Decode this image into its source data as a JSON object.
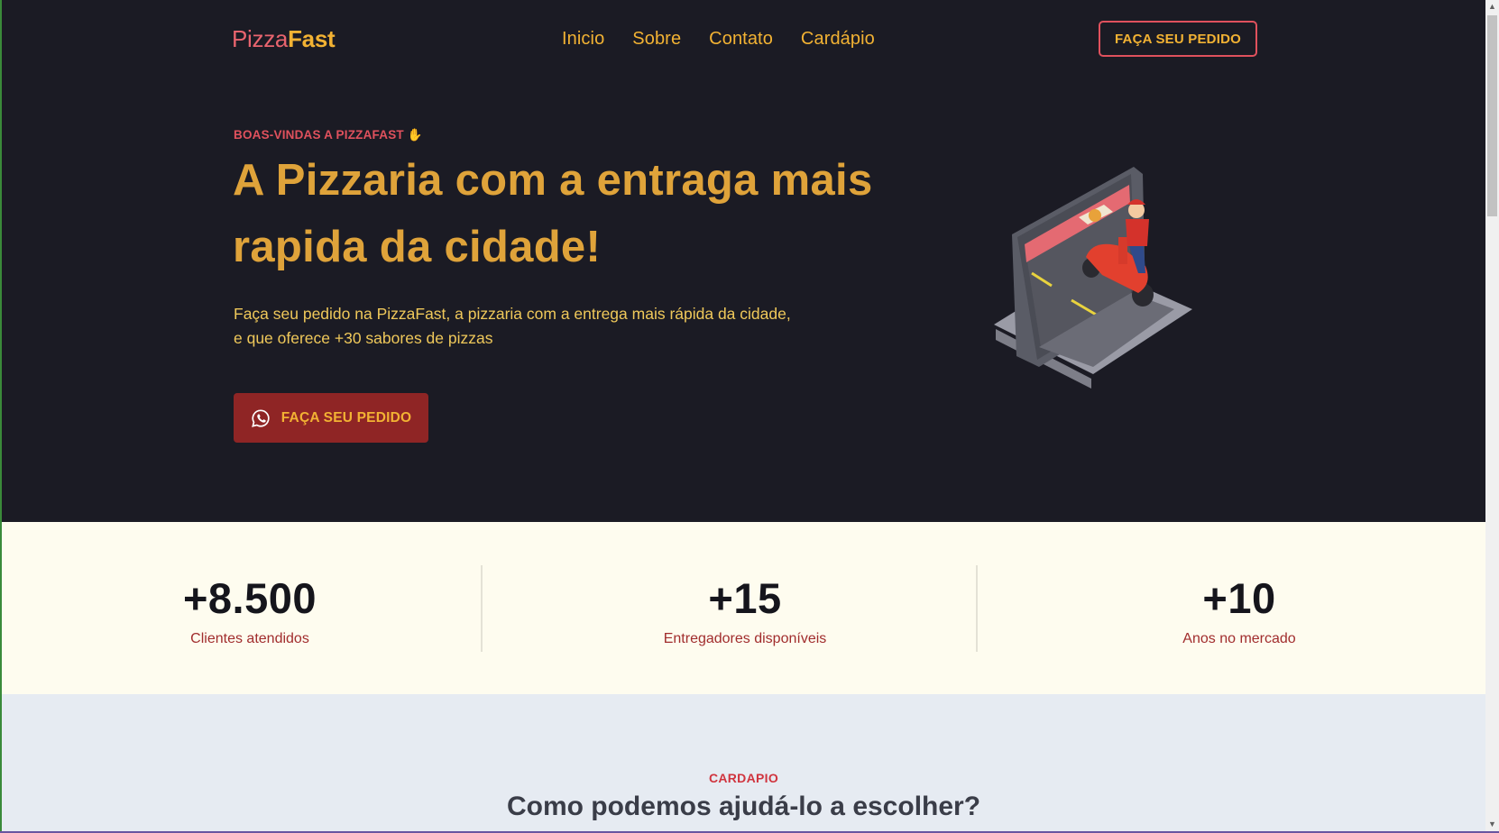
{
  "brand": {
    "part1": "Pizza",
    "part2": "Fast"
  },
  "nav": {
    "items": [
      "Inicio",
      "Sobre",
      "Contato",
      "Cardápio"
    ]
  },
  "header": {
    "cta_label": "FAÇA SEU PEDIDO"
  },
  "hero": {
    "eyebrow": "BOAS-VINDAS A PIZZAFAST",
    "eyebrow_icon": "waving-hand-icon",
    "headline_line1": "A Pizzaria com a entraga mais",
    "headline_line2": "rapida da cidade!",
    "lead_line1": "Faça seu pedido na PizzaFast, a pizzaria com a entrega mais rápida da cidade,",
    "lead_line2": "e que oferece +30 sabores de pizzas",
    "cta_label": "FAÇA SEU PEDIDO",
    "cta_icon": "whatsapp-icon",
    "illustration": "delivery-scooter-phone-illustration"
  },
  "stats": [
    {
      "value": "+8.500",
      "label": "Clientes atendidos"
    },
    {
      "value": "+15",
      "label": "Entregadores disponíveis"
    },
    {
      "value": "+10",
      "label": "Anos no mercado"
    }
  ],
  "menu_section": {
    "kicker": "CARDAPIO",
    "title": "Como podemos ajudá-lo a escolher?"
  },
  "colors": {
    "hero_bg": "#1b1b24",
    "accent_yellow": "#f2b233",
    "accent_red": "#e0515d",
    "button_red": "#8f2525",
    "stats_bg": "#fefcef",
    "menu_bg": "#e6ebf2"
  }
}
